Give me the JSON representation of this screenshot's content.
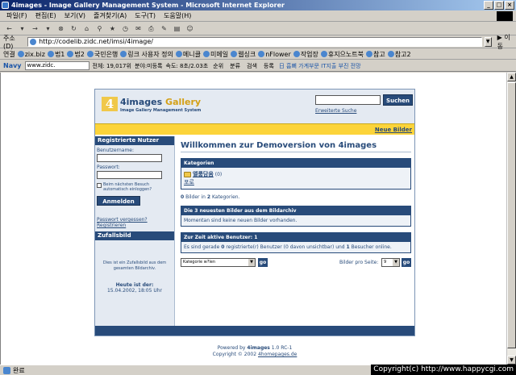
{
  "window": {
    "title": "4images - Image Gallery Management System - Microsoft Internet Explorer"
  },
  "menu": [
    "파일(F)",
    "편집(E)",
    "보기(V)",
    "즐겨찾기(A)",
    "도구(T)",
    "도움말(H)"
  ],
  "address": {
    "label": "주소(D)",
    "url": "http://codelib.zidc.net/imsi/4image/",
    "go": "이동"
  },
  "links": {
    "label": "연결",
    "items": [
      "zix.biz",
      "법1",
      "법2",
      "국민은행",
      "링크 사용자 정의",
      "메니클",
      "미메일",
      "웹싱크",
      "nFlower",
      "작업장",
      "휴지으노트북",
      "참고",
      "참고2"
    ]
  },
  "naver": {
    "logo": "Navy",
    "search": "www.zidc.",
    "text1": "전체: 19,017위",
    "text2": "분야:미등록",
    "text3": "속도: 8초/2.03초",
    "btn1": "순위",
    "btn2": "분류",
    "btn3": "검색",
    "btn4": "등록",
    "news": "日 흡뼈 가계부문 IT지출 부진 전망"
  },
  "site": {
    "logo_num": "4",
    "logo_title_a": "4images",
    "logo_title_b": "Gallery",
    "logo_sub": "Image Gallery Management System",
    "search_btn": "Suchen",
    "adv_search": "Erweiterte Suche",
    "new_images": "Neue Bilder",
    "login": {
      "head": "Registrierte Nutzer",
      "user_label": "Benutzername:",
      "pass_label": "Passwort:",
      "remember": "Beim nächsten Besuch automatisch einloggen?",
      "button": "Anmelden",
      "forgot": "Passwort vergessen?",
      "register": "Registrieren"
    },
    "random": {
      "head": "Zufallsbild",
      "text": "Dies ist ein Zufallsbild aus dem gesamten Bildarchiv.",
      "date_label": "Heute ist der:",
      "date_value": "15.04.2002, 18:05 Uhr"
    },
    "welcome": "Willkommen zur Demoversion von 4images",
    "categories": {
      "head": "Kategorien",
      "item": "앨룸담움",
      "count": "(0)",
      "sub": "포로"
    },
    "info": {
      "n1": "0",
      "t1": "Bilder in",
      "n2": "2",
      "t2": "Kategorien."
    },
    "newest": {
      "head": "Die 3 neuesten Bilder aus dem Bildarchiv",
      "body": "Momentan sind keine neuen Bilder vorhanden."
    },
    "active": {
      "head": "Zur Zeit aktive Benutzer: 1",
      "p1": "Es sind gerade",
      "n1": "0",
      "p2": "registrierte(r) Benutzer (0 davon unsichtbar) und",
      "n2": "1",
      "p3": "Besucher online."
    },
    "controls": {
      "cat_select": "Kategorie w?len",
      "go": "go",
      "per_page_label": "Bilder pro Seite:",
      "per_page_value": "9"
    }
  },
  "powered": {
    "line1_prefix": "Powered by",
    "line1_name": "4images",
    "line1_ver": "1.0 RC-1",
    "line2_prefix": "Copyright © 2002",
    "line2_link": "4homepages.de"
  },
  "status": "완료",
  "overlay": "Copyright(c) http://www.happycgi.com"
}
